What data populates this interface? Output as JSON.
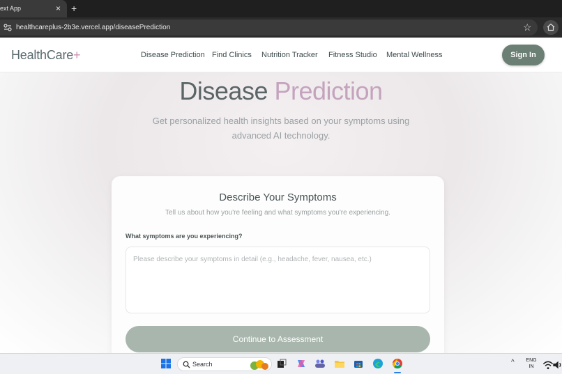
{
  "browser": {
    "tab_title": "ext App",
    "close_glyph": "×",
    "new_tab_glyph": "+",
    "url": "healthcareplus-2b3e.vercel.app/diseasePrediction",
    "star_glyph": "☆"
  },
  "header": {
    "logo_main": "HealthCare",
    "logo_plus": "+",
    "nav": [
      "Disease Prediction",
      "Find Clinics",
      "Nutrition Tracker",
      "Fitness Studio",
      "Mental Wellness"
    ],
    "signin_label": "Sign In"
  },
  "hero": {
    "title_part1": "Disease",
    "title_part2": "Prediction",
    "subtitle": "Get personalized health insights based on your symptoms using advanced AI technology."
  },
  "card": {
    "title": "Describe Your Symptoms",
    "subtitle": "Tell us about how you're feeling and what symptoms you're experiencing.",
    "field_label": "What symptoms are you experiencing?",
    "input_placeholder": "Please describe your symptoms in detail (e.g., headache, fever, nausea, etc.)",
    "input_value": "",
    "button_label": "Continue to Assessment"
  },
  "taskbar": {
    "search_label": "Search",
    "lang_line1": "ENG",
    "lang_line2": "IN",
    "tray_up_glyph": "^",
    "icons": [
      "windows-start-icon",
      "search-icon",
      "widgets-icon",
      "task-view-icon",
      "copilot-icon",
      "teams-icon",
      "file-explorer-icon",
      "store-icon",
      "edge-icon",
      "chrome-icon",
      "wifi-icon",
      "volume-icon"
    ]
  },
  "colors": {
    "brand_accent": "#c4a3bd",
    "signin_bg": "#6b7f74",
    "button_bg": "#a8b6ad",
    "text_dark": "#4a5456"
  }
}
